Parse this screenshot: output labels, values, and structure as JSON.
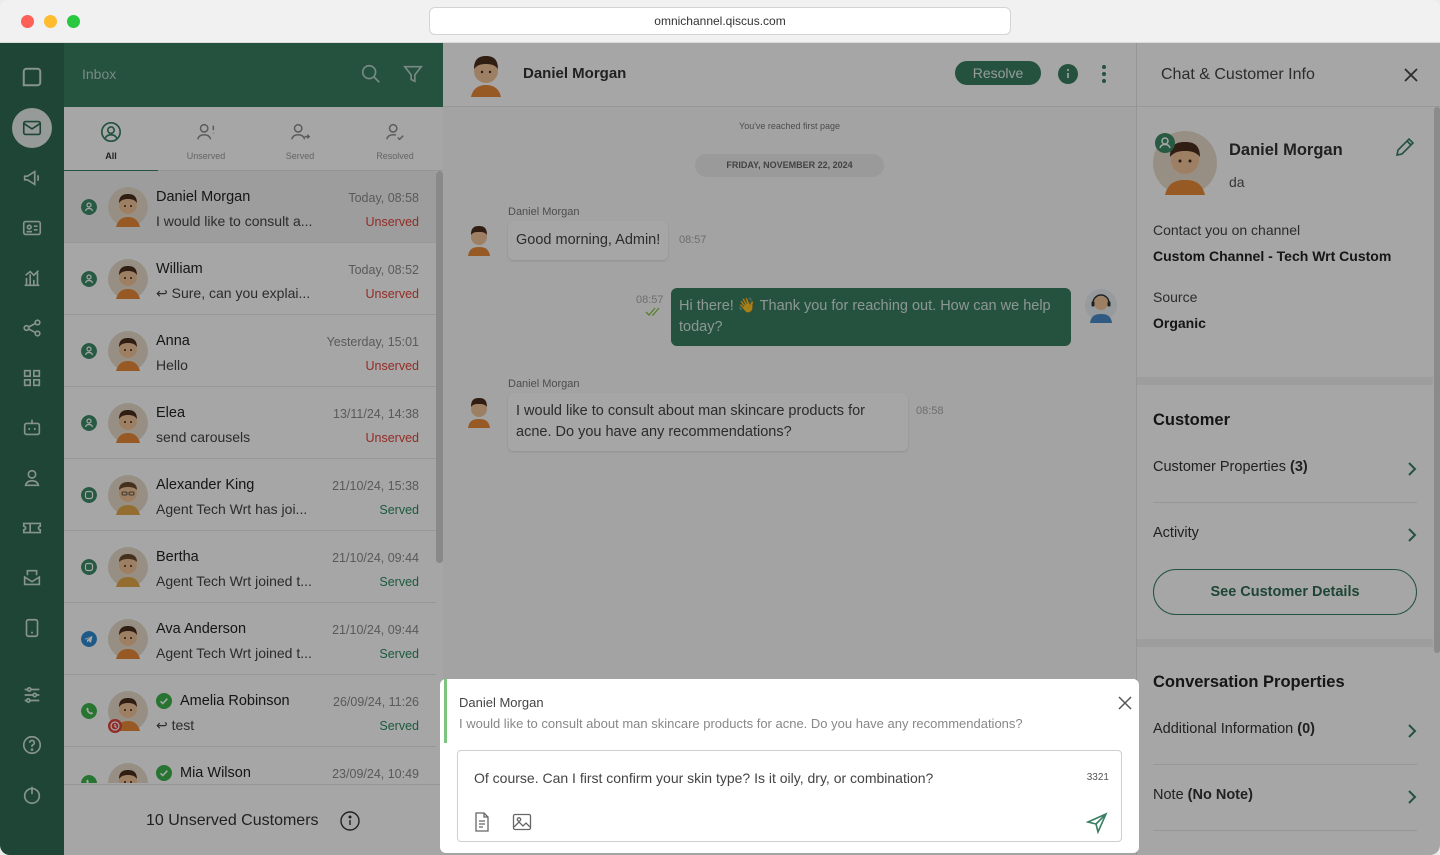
{
  "browser": {
    "url": "omnichannel.qiscus.com"
  },
  "inbox": {
    "title": "Inbox",
    "tabs": [
      {
        "label": "All"
      },
      {
        "label": "Unserved"
      },
      {
        "label": "Served"
      },
      {
        "label": "Resolved"
      }
    ],
    "conversations": [
      {
        "name": "Daniel Morgan",
        "time": "Today, 08:58",
        "message": "I would like to consult a...",
        "status": "Unserved",
        "channel": "custom",
        "reply": false
      },
      {
        "name": "William",
        "time": "Today, 08:52",
        "message": "Sure, can you explai...",
        "status": "Unserved",
        "channel": "custom",
        "reply": true
      },
      {
        "name": "Anna",
        "time": "Yesterday, 15:01",
        "message": "Hello",
        "status": "Unserved",
        "channel": "custom",
        "reply": false
      },
      {
        "name": "Elea",
        "time": "13/11/24, 14:38",
        "message": "send carousels",
        "status": "Unserved",
        "channel": "custom",
        "reply": false
      },
      {
        "name": "Alexander King",
        "time": "21/10/24, 15:38",
        "message": "Agent Tech Wrt has joi...",
        "status": "Served",
        "channel": "qiscus",
        "reply": false
      },
      {
        "name": "Bertha",
        "time": "21/10/24, 09:44",
        "message": "Agent Tech Wrt joined t...",
        "status": "Served",
        "channel": "qiscus",
        "reply": false
      },
      {
        "name": "Ava Anderson",
        "time": "21/10/24, 09:44",
        "message": "Agent Tech Wrt joined t...",
        "status": "Served",
        "channel": "telegram",
        "reply": false
      },
      {
        "name": "Amelia Robinson",
        "time": "26/09/24, 11:26",
        "message": "test",
        "status": "Served",
        "channel": "whatsapp",
        "reply": true
      },
      {
        "name": "Mia Wilson",
        "time": "23/09/24, 10:49",
        "message": "",
        "status": "",
        "channel": "whatsapp",
        "reply": false
      }
    ],
    "footer": "10 Unserved Customers"
  },
  "chat": {
    "customer_name": "Daniel Morgan",
    "resolve_label": "Resolve",
    "first_page_notice": "You've reached first page",
    "date_label": "FRIDAY, NOVEMBER 22, 2024",
    "messages": [
      {
        "sender": "Daniel Morgan",
        "text": "Good morning, Admin!",
        "time": "08:57",
        "direction": "in"
      },
      {
        "sender": "",
        "text": "Hi there! 👋 Thank you for reaching out. How can we help today?",
        "time": "08:57",
        "direction": "out"
      },
      {
        "sender": "Daniel Morgan",
        "text": "I would like to consult about man skincare products for acne. Do you have any recommendations?",
        "time": "08:58",
        "direction": "in"
      }
    ],
    "reply_to": {
      "name": "Daniel Morgan",
      "text": "I would like to consult about man skincare products for acne. Do you have any recommendations?"
    },
    "composer": {
      "value": "Of course. Can I first confirm your skin type? Is it oily, dry, or combination?",
      "char_count": "3321"
    }
  },
  "info_panel": {
    "title": "Chat & Customer Info",
    "customer_name": "Daniel Morgan",
    "customer_sub": "da",
    "contact_label": "Contact you on channel",
    "contact_value": "Custom Channel - Tech Wrt Custom",
    "source_label": "Source",
    "source_value": "Organic",
    "customer_section": "Customer",
    "customer_properties_label": "Customer Properties",
    "customer_properties_count": "(3)",
    "activity_label": "Activity",
    "see_details_label": "See Customer Details",
    "conversation_section": "Conversation Properties",
    "additional_info_label": "Additional Information",
    "additional_info_count": "(0)",
    "note_label": "Note",
    "note_value": "(No Note)"
  },
  "colors": {
    "brand_dark": "#2E6B52",
    "brand": "#387E62",
    "unserved": "#E0443D",
    "served": "#2D8A5F"
  }
}
